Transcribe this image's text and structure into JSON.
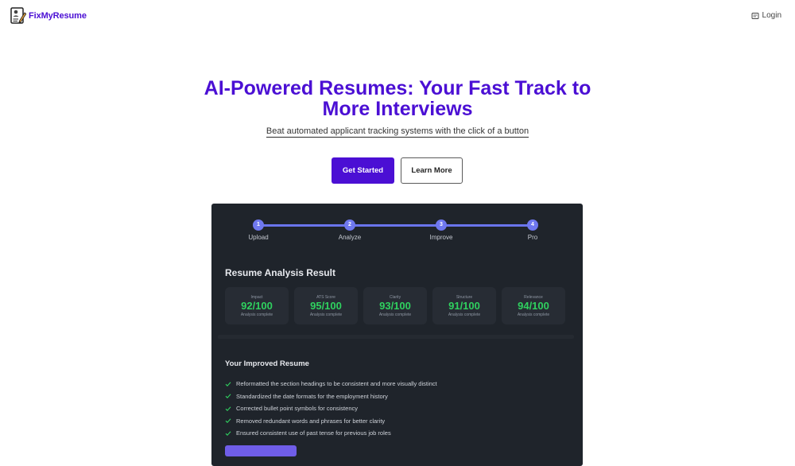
{
  "brand": {
    "name": "FixMyResume",
    "logo_icon": "resume-pen-icon"
  },
  "nav": {
    "login_label": "Login",
    "login_icon": "login-icon"
  },
  "hero": {
    "title_line1": "AI-Powered Resumes: Your Fast Track to",
    "title_line2": "More Interviews",
    "subtitle": "Beat automated applicant tracking systems with the click of a button",
    "primary_cta": "Get Started",
    "secondary_cta": "Learn More"
  },
  "stepper": {
    "steps": [
      {
        "number": "1",
        "label": "Upload"
      },
      {
        "number": "2",
        "label": "Analyze"
      },
      {
        "number": "3",
        "label": "Improve"
      },
      {
        "number": "4",
        "label": "Pro"
      }
    ]
  },
  "analysis": {
    "title": "Resume Analysis Result",
    "scores": [
      {
        "label": "Impact",
        "value": "92/100",
        "status": "Analysis complete"
      },
      {
        "label": "ATS Score",
        "value": "95/100",
        "status": "Analysis complete"
      },
      {
        "label": "Clarity",
        "value": "93/100",
        "status": "Analysis complete"
      },
      {
        "label": "Structure",
        "value": "91/100",
        "status": "Analysis complete"
      },
      {
        "label": "Relevance",
        "value": "94/100",
        "status": "Analysis complete"
      }
    ]
  },
  "improved": {
    "title": "Your Improved Resume",
    "items": [
      "Reformatted the section headings to be consistent and more visually distinct",
      "Standardized the date formats for the employment history",
      "Corrected bullet point symbols for consistency",
      "Removed redundant words and phrases for better clarity",
      "Ensured consistent use of past tense for previous job roles"
    ]
  },
  "colors": {
    "brand": "#4b0fd4",
    "panel_bg": "#1f242b",
    "card_bg": "#272c34",
    "score_green": "#2fd15f",
    "stepper": "#6f78ef"
  }
}
